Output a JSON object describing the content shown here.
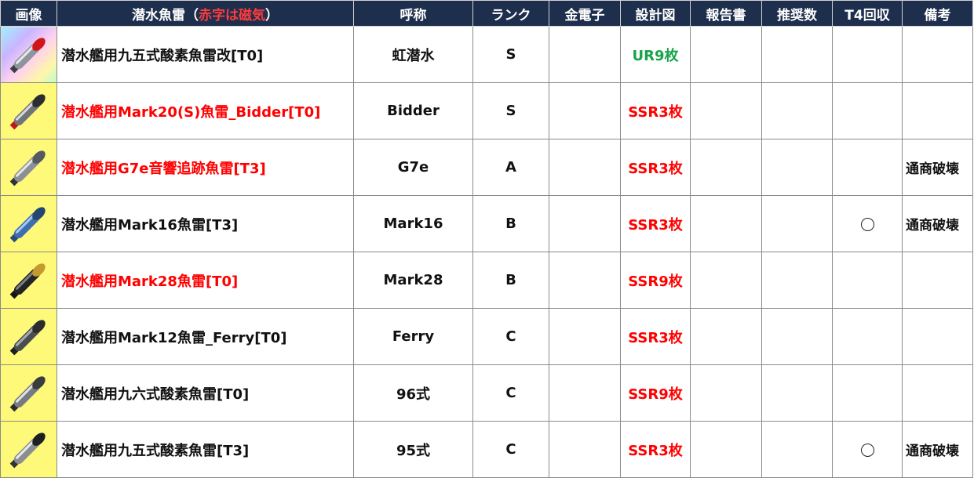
{
  "headers": {
    "image": "画像",
    "name_prefix": "潜水魚雷（",
    "name_magnetic": "赤字は磁気",
    "name_suffix": "）",
    "callname": "呼称",
    "rank": "ランク",
    "gold_electron": "金電子",
    "blueprint": "設計図",
    "report": "報告書",
    "recommended": "推奨数",
    "t4_recovery": "T4回収",
    "notes": "備考"
  },
  "colors": {
    "header_bg": "#1e2f4d",
    "magnetic_red": "#ff0000",
    "ur_green": "#16a34a",
    "ssr_yellow": "#fff97a"
  },
  "rows": [
    {
      "name": "潜水艦用九五式酸素魚雷改[T0]",
      "magnetic": false,
      "callname": "虹潜水",
      "rank": "S",
      "gold_electron": "",
      "blueprint": "UR9枚",
      "blueprint_color": "green",
      "report": "",
      "recommended": "",
      "t4": "",
      "note": "",
      "img_bg": "ur",
      "icon": "red-tip-torpedo-icon"
    },
    {
      "name": "潜水艦用Mark20(S)魚雷_Bidder[T0]",
      "magnetic": true,
      "callname": "Bidder",
      "rank": "S",
      "gold_electron": "",
      "blueprint": "SSR3枚",
      "blueprint_color": "red",
      "report": "",
      "recommended": "",
      "t4": "",
      "note": "",
      "img_bg": "ssr",
      "icon": "red-tail-torpedo-icon"
    },
    {
      "name": "潜水艦用G7e音響追跡魚雷[T3]",
      "magnetic": true,
      "callname": "G7e",
      "rank": "A",
      "gold_electron": "",
      "blueprint": "SSR3枚",
      "blueprint_color": "red",
      "report": "",
      "recommended": "",
      "t4": "",
      "note": "通商破壊",
      "img_bg": "ssr",
      "icon": "grey-torpedo-icon"
    },
    {
      "name": "潜水艦用Mark16魚雷[T3]",
      "magnetic": false,
      "callname": "Mark16",
      "rank": "B",
      "gold_electron": "",
      "blueprint": "SSR3枚",
      "blueprint_color": "red",
      "report": "",
      "recommended": "",
      "t4": "○",
      "note": "通商破壊",
      "img_bg": "ssr",
      "icon": "blue-torpedo-icon"
    },
    {
      "name": "潜水艦用Mark28魚雷[T0]",
      "magnetic": true,
      "callname": "Mark28",
      "rank": "B",
      "gold_electron": "",
      "blueprint": "SSR9枚",
      "blueprint_color": "red",
      "report": "",
      "recommended": "",
      "t4": "",
      "note": "",
      "img_bg": "ssr",
      "icon": "dark-torpedo-icon"
    },
    {
      "name": "潜水艦用Mark12魚雷_Ferry[T0]",
      "magnetic": false,
      "callname": "Ferry",
      "rank": "C",
      "gold_electron": "",
      "blueprint": "SSR3枚",
      "blueprint_color": "red",
      "report": "",
      "recommended": "",
      "t4": "",
      "note": "",
      "img_bg": "ssr",
      "icon": "dark-grey-torpedo-icon"
    },
    {
      "name": "潜水艦用九六式酸素魚雷[T0]",
      "magnetic": false,
      "callname": "96式",
      "rank": "C",
      "gold_electron": "",
      "blueprint": "SSR9枚",
      "blueprint_color": "red",
      "report": "",
      "recommended": "",
      "t4": "",
      "note": "",
      "img_bg": "ssr",
      "icon": "silver-torpedo-icon"
    },
    {
      "name": "潜水艦用九五式酸素魚雷[T3]",
      "magnetic": false,
      "callname": "95式",
      "rank": "C",
      "gold_electron": "",
      "blueprint": "SSR3枚",
      "blueprint_color": "red",
      "report": "",
      "recommended": "",
      "t4": "○",
      "note": "通商破壊",
      "img_bg": "ssr",
      "icon": "silver-dark-tip-torpedo-icon"
    }
  ]
}
